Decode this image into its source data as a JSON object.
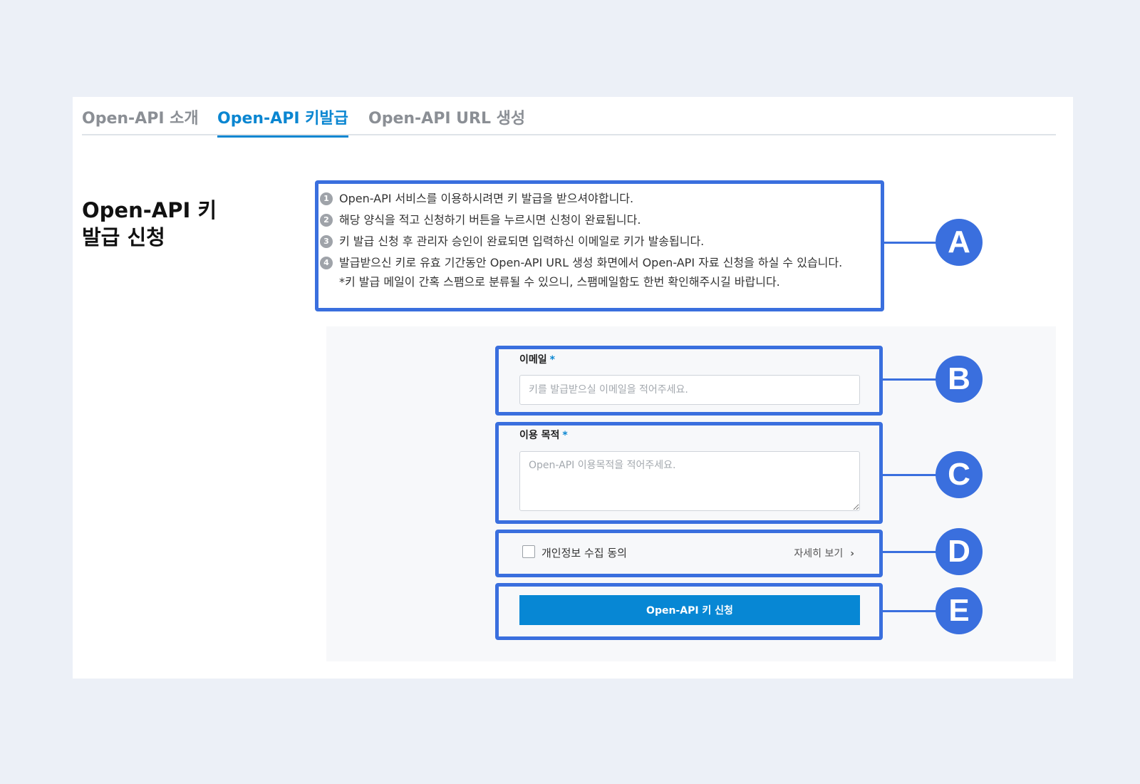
{
  "tabs": [
    {
      "label": "Open-API 소개",
      "active": false
    },
    {
      "label": "Open-API 키발급",
      "active": true
    },
    {
      "label": "Open-API URL 생성",
      "active": false
    }
  ],
  "section": {
    "title": "Open-API 키\n발급 신청"
  },
  "info": {
    "items": [
      {
        "num": "1",
        "text": "Open-API 서비스를 이용하시려면 키 발급을 받으셔야합니다."
      },
      {
        "num": "2",
        "text": "해당 양식을 적고 신청하기 버튼을 누르시면 신청이 완료됩니다."
      },
      {
        "num": "3",
        "text": "키 발급 신청 후 관리자 승인이 완료되면 입력하신 이메일로 키가 발송됩니다."
      },
      {
        "num": "4",
        "text": "발급받으신 키로 유효 기간동안 Open-API URL 생성 화면에서 Open-API 자료 신청을 하실 수 있습니다."
      }
    ],
    "note": "*키 발급 메일이 간혹 스팸으로 분류될 수 있으니, 스팸메일함도 한번 확인해주시길 바랍니다."
  },
  "form": {
    "email": {
      "label": "이메일",
      "required_mark": "*",
      "value": "",
      "placeholder": "키를 발급받으실 이메일을 적어주세요."
    },
    "purpose": {
      "label": "이용 목적",
      "required_mark": "*",
      "value": "",
      "placeholder": "Open-API 이용목적을 적어주세요."
    },
    "consent": {
      "label": "개인정보 수집 동의",
      "checked": false,
      "detail_link": "자세히 보기",
      "detail_icon": "chevron-right-icon"
    },
    "submit_label": "Open-API 키 신청"
  },
  "annotations": {
    "color": "#3a6fde",
    "markers": [
      "A",
      "B",
      "C",
      "D",
      "E"
    ]
  },
  "colors": {
    "accent": "#0a86d1",
    "button": "#0787d4",
    "background": "#ecf0f7"
  }
}
